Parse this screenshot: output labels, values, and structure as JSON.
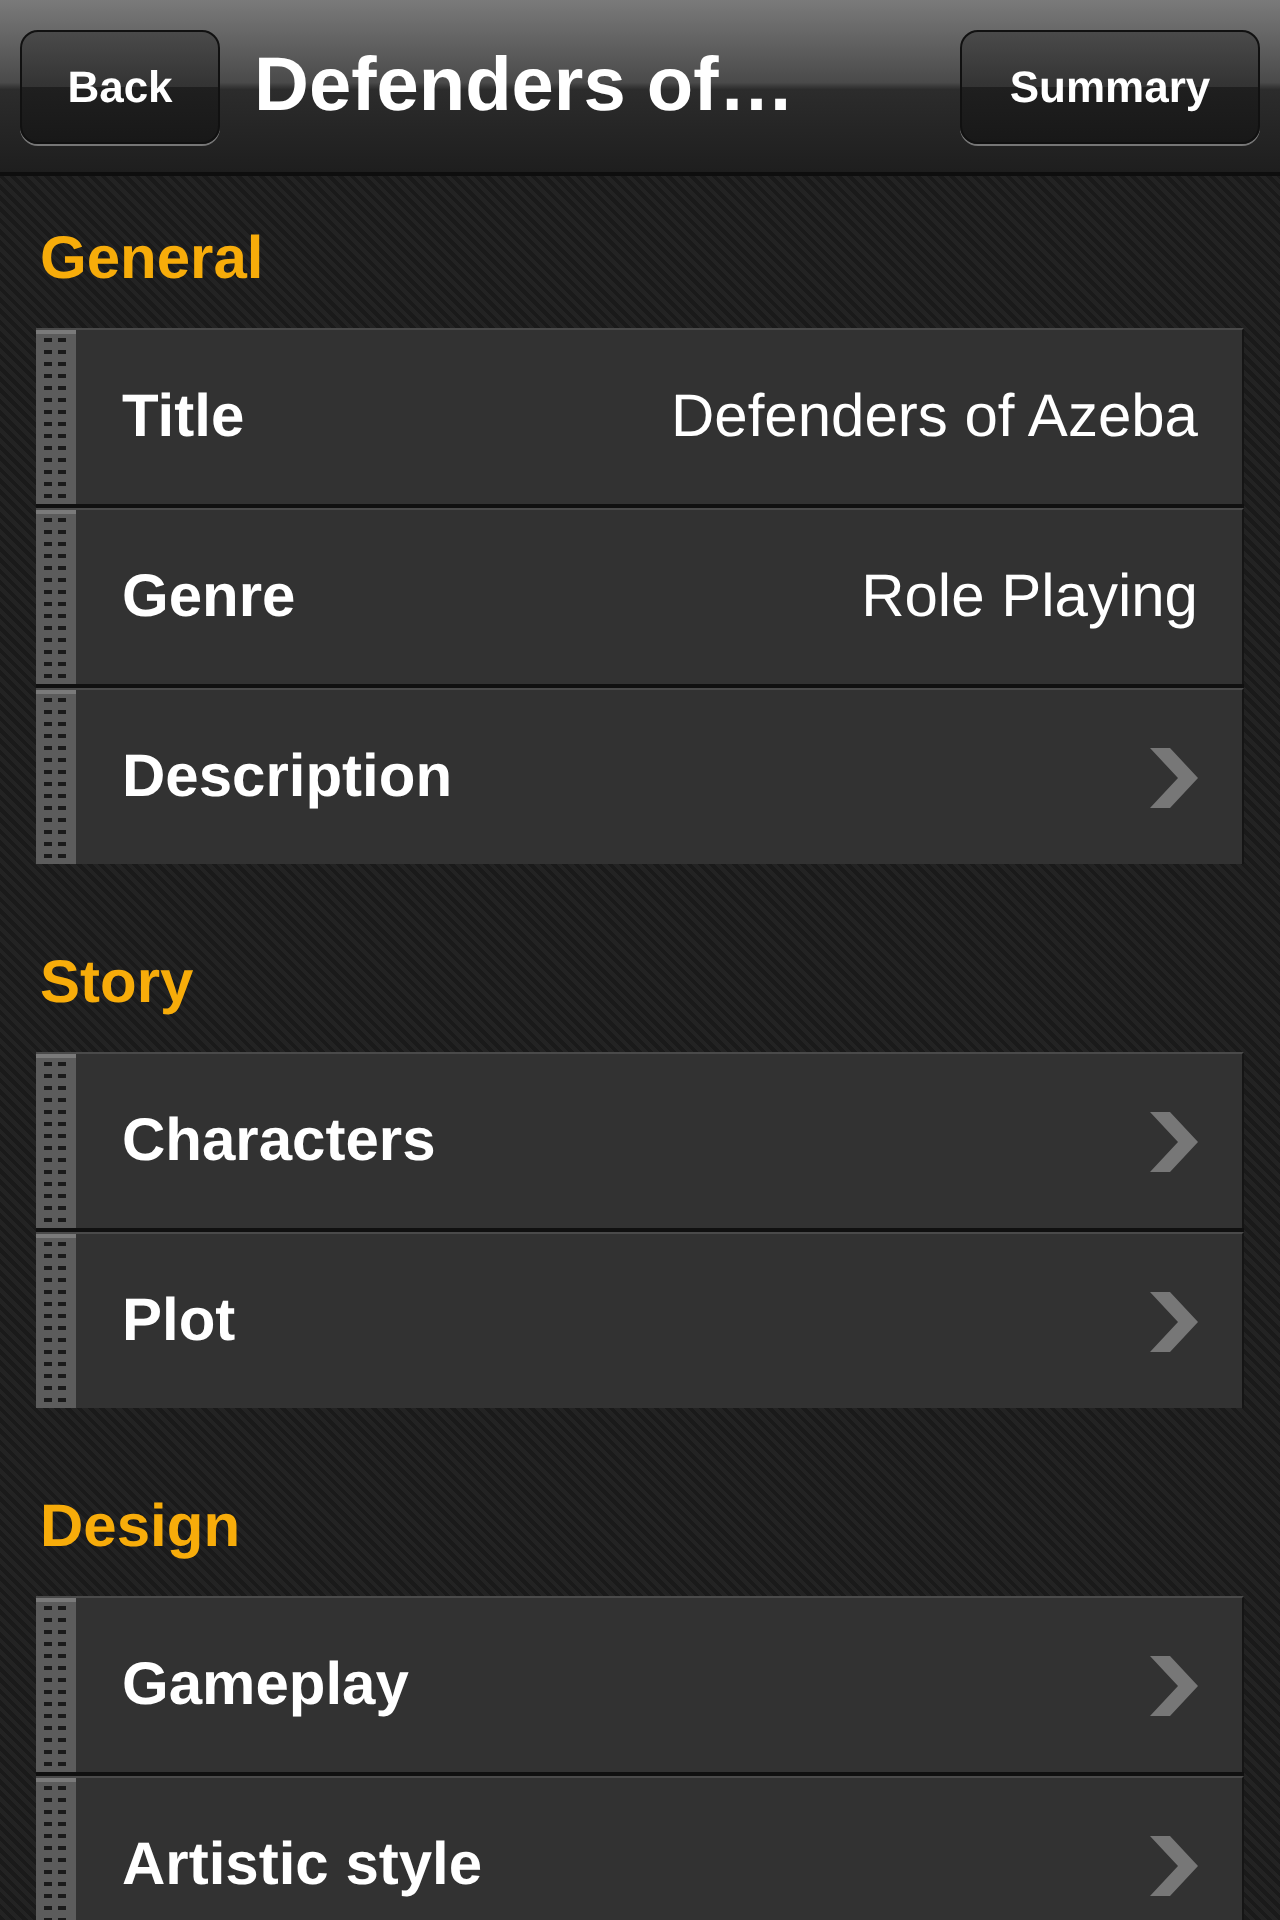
{
  "nav_bar": {
    "back_button": "Back",
    "title": "Defenders of…",
    "summary_button": "Summary"
  },
  "sections": [
    {
      "header": "General",
      "rows": [
        {
          "kind": "value",
          "label": "Title",
          "value": "Defenders of Azeba"
        },
        {
          "kind": "value",
          "label": "Genre",
          "value": "Role Playing"
        },
        {
          "kind": "disclosure",
          "label": "Description"
        }
      ]
    },
    {
      "header": "Story",
      "rows": [
        {
          "kind": "disclosure",
          "label": "Characters"
        },
        {
          "kind": "disclosure",
          "label": "Plot"
        }
      ]
    },
    {
      "header": "Design",
      "rows": [
        {
          "kind": "disclosure",
          "label": "Gameplay"
        },
        {
          "kind": "disclosure",
          "label": "Artistic style"
        }
      ]
    }
  ]
}
